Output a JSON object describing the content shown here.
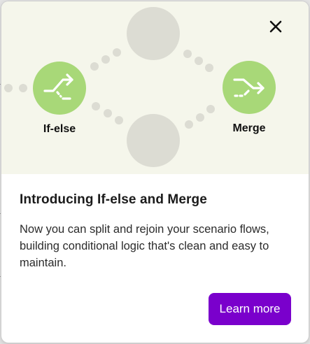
{
  "modal": {
    "close_icon": "close-icon",
    "illustration": {
      "nodes": [
        {
          "label": "If-else",
          "icon": "split-arrows-icon",
          "color": "#a8d878"
        },
        {
          "label": "Merge",
          "icon": "merge-arrows-icon",
          "color": "#a8d878"
        }
      ],
      "placeholder_color": "#dcdcd3",
      "background_color": "#f5f6eb"
    },
    "title": "Introducing If-else and Merge",
    "description": "Now you can split and rejoin your scenario flows, building conditional logic that's clean and easy to maintain.",
    "learn_more_label": "Learn more",
    "accent_color": "#7a00cc"
  }
}
